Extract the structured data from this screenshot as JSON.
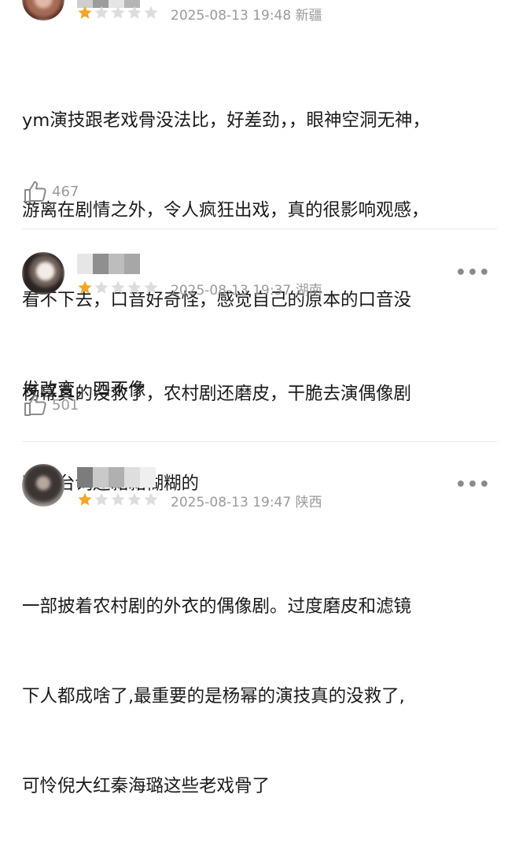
{
  "reviews": [
    {
      "rating": 1,
      "max_rating": 5,
      "date": "2025-08-13 19:48",
      "location": "新疆",
      "text_lines": [
        "ym演技跟老戏骨没法比，好差劲，，眼神空洞无神，",
        "游离在剧情之外，令人疯狂出戏，真的很影响观感，",
        "看不下去，口音好奇怪，感觉自己的原本的口音没",
        "发改变，四不像"
      ],
      "likes": "467",
      "like_icon": "thumbs-up-icon"
    },
    {
      "rating": 1,
      "max_rating": 5,
      "date": "2025-08-13 19:37",
      "location": "湖南",
      "text_lines": [
        "杨幂真的没救了，农村剧还磨皮，干脆去演偶像剧",
        "啊，台词还黏黏糊糊的"
      ],
      "likes": "501",
      "like_icon": "thumbs-up-icon"
    },
    {
      "rating": 1,
      "max_rating": 5,
      "date": "2025-08-13 19:47",
      "location": "陕西",
      "text_lines": [
        "一部披着农村剧的外衣的偶像剧。过度磨皮和滤镜",
        "下人都成啥了,最重要的是杨幂的演技真的没救了,",
        "可怜倪大红秦海璐这些老戏骨了"
      ],
      "likes": "",
      "like_icon": "thumbs-up-icon"
    }
  ],
  "more_icon": "more-dots-icon",
  "star_colors": {
    "filled": "#f5a623",
    "empty": "#dddddd"
  }
}
